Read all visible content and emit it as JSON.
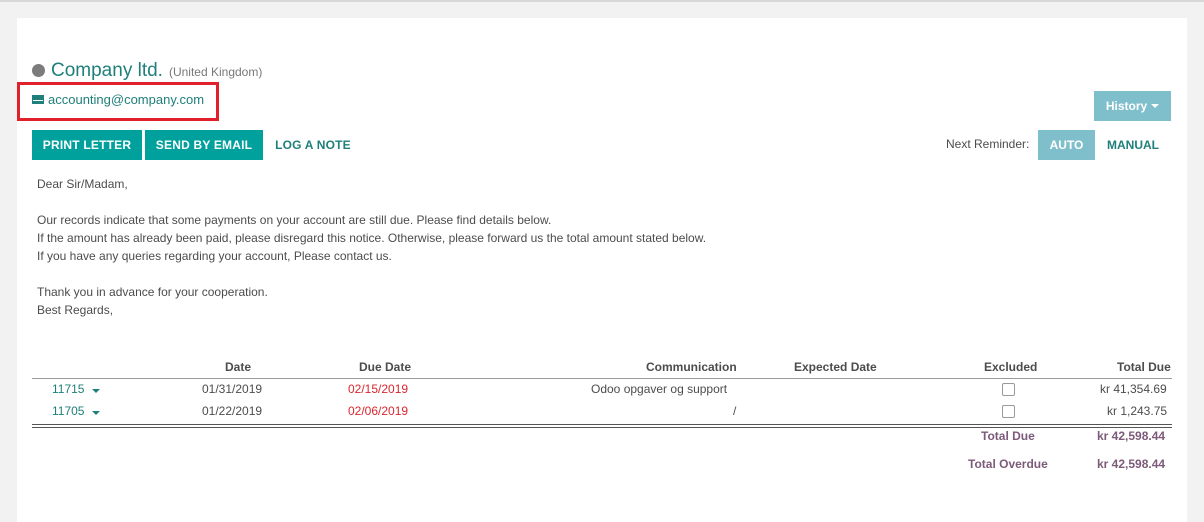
{
  "partner": {
    "name": "Company ltd.",
    "country": "(United Kingdom)",
    "email": "accounting@company.com"
  },
  "toolbar": {
    "history_label": "History",
    "print_letter_label": "PRINT LETTER",
    "send_email_label": "SEND BY EMAIL",
    "log_note_label": "LOG A NOTE",
    "next_reminder_label": "Next Reminder:",
    "auto_label": "AUTO",
    "manual_label": "MANUAL"
  },
  "letter": {
    "greeting": "Dear Sir/Madam,",
    "line1": "Our records indicate that some payments on your account are still due. Please find details below.",
    "line2": "If the amount has already been paid, please disregard this notice. Otherwise, please forward us the total amount stated below.",
    "line3": "If you have any queries regarding your account, Please contact us.",
    "thanks": "Thank you in advance for your cooperation.",
    "closing": "Best Regards,"
  },
  "table": {
    "headers": {
      "date": "Date",
      "due_date": "Due Date",
      "communication": "Communication",
      "expected_date": "Expected Date",
      "excluded": "Excluded",
      "total_due": "Total Due"
    },
    "rows": [
      {
        "ref": "11715",
        "date": "01/31/2019",
        "due_date": "02/15/2019",
        "communication": "Odoo opgaver og support",
        "expected_date": "",
        "excluded": false,
        "total_due": "kr 41,354.69"
      },
      {
        "ref": "11705",
        "date": "01/22/2019",
        "due_date": "02/06/2019",
        "communication": "/",
        "expected_date": "",
        "excluded": false,
        "total_due": "kr 1,243.75"
      }
    ],
    "total_due_label": "Total Due",
    "total_due_value": "kr 42,598.44",
    "total_overdue_label": "Total Overdue",
    "total_overdue_value": "kr 42,598.44"
  },
  "colors": {
    "accent": "#00a09d",
    "link": "#1f7f7a",
    "overdue": "#d9262f",
    "highlight_box": "#e0212b",
    "secondary_button": "#7fbfcb"
  },
  "icons": {
    "status": "circle-icon",
    "email": "envelope-icon",
    "dropdown": "caret-down-icon"
  }
}
